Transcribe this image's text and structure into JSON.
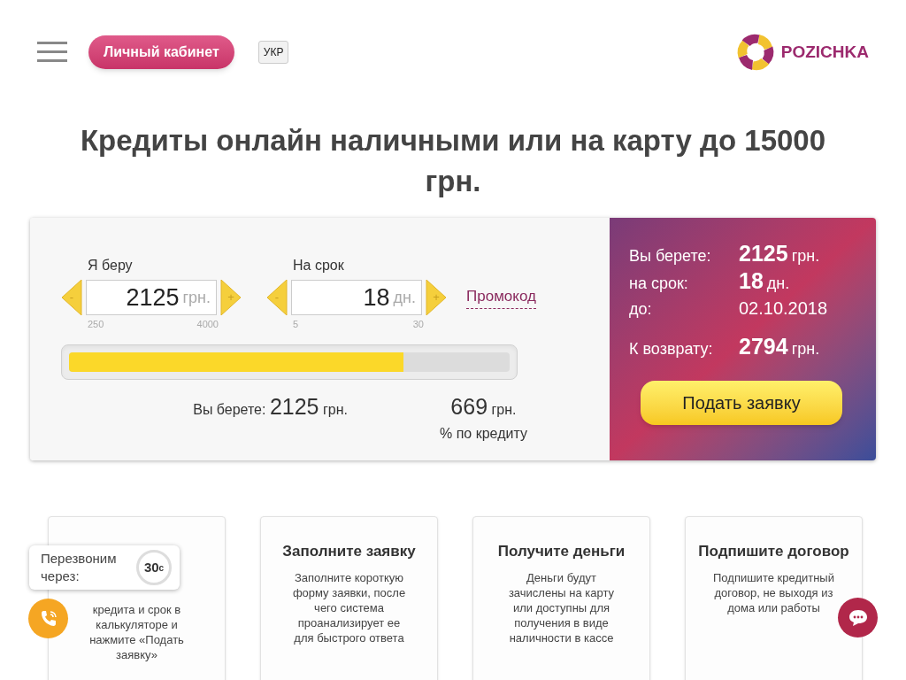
{
  "header": {
    "account_button": "Личный кабинет",
    "language_button": "УКР",
    "logo_text": "POZICHKA"
  },
  "headline": "Кредиты онлайн наличными или на карту до 15000 грн.",
  "calculator": {
    "amount": {
      "label": "Я беру",
      "value": "2125",
      "unit": "грн.",
      "min": "250",
      "max": "4000",
      "minus": "-",
      "plus": "+"
    },
    "term": {
      "label": "На срок",
      "value": "18",
      "unit": "дн.",
      "min": "5",
      "max": "30",
      "minus": "-",
      "plus": "+"
    },
    "promo_link": "Промокод",
    "slider": {
      "level": 0.76
    },
    "you_take": {
      "label": "Вы берете:",
      "value": "2125",
      "unit": "грн."
    },
    "interest": {
      "value": "669",
      "unit": "грн.",
      "label": "% по кредиту"
    }
  },
  "summary": {
    "rows": [
      {
        "label": "Вы берете:",
        "value": "2125",
        "unit": "грн."
      },
      {
        "label": "на срок:",
        "value": "18",
        "unit": "дн."
      },
      {
        "label": "до:",
        "value": "02.10.2018"
      },
      {
        "label": "К возврату:",
        "value": "2794",
        "unit": "грн."
      }
    ],
    "submit_button": "Подать заявку"
  },
  "steps": [
    {
      "description": "кредита и срок в калькуляторе и нажмите «Подать заявку»"
    },
    {
      "title": "Заполните заявку",
      "description": "Заполните короткую форму заявки, после чего система проанализирует ее для быстрого ответа"
    },
    {
      "title": "Получите деньги",
      "description": "Деньги будут зачислены на карту или доступны для получения в виде наличности в кассе"
    },
    {
      "title": "Подпишите договор",
      "description": "Подпишите кредитный договор, не выходя из дома или работы"
    }
  ],
  "callback_popup": {
    "text": "Перезвоним через:",
    "timer": "30",
    "timer_unit": "с"
  }
}
